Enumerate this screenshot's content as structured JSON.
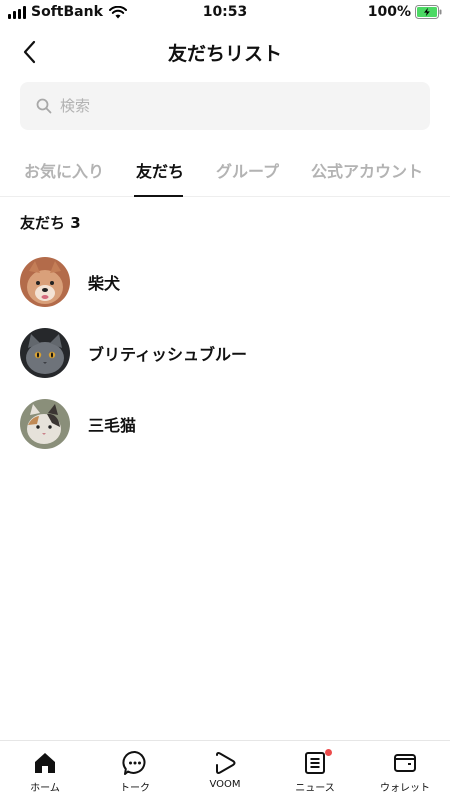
{
  "status_bar": {
    "carrier": "SoftBank",
    "time": "10:53",
    "battery": "100%"
  },
  "header": {
    "title": "友だちリスト"
  },
  "search": {
    "placeholder": "検索"
  },
  "tabs": [
    {
      "label": "お気に入り",
      "active": false
    },
    {
      "label": "友だち",
      "active": true
    },
    {
      "label": "グループ",
      "active": false
    },
    {
      "label": "公式アカウント",
      "active": false
    }
  ],
  "section": {
    "title": "友だち 3"
  },
  "friends": [
    {
      "name": "柴犬",
      "avatar": "shiba-dog-photo"
    },
    {
      "name": "ブリティッシュブルー",
      "avatar": "british-blue-cat-photo"
    },
    {
      "name": "三毛猫",
      "avatar": "calico-cat-photo"
    }
  ],
  "bottom_nav": [
    {
      "label": "ホーム",
      "icon": "home-icon",
      "active": true
    },
    {
      "label": "トーク",
      "icon": "chat-icon",
      "active": false
    },
    {
      "label": "VOOM",
      "icon": "voom-icon",
      "active": false
    },
    {
      "label": "ニュース",
      "icon": "news-icon",
      "active": false,
      "badge": true
    },
    {
      "label": "ウォレット",
      "icon": "wallet-icon",
      "active": false
    }
  ],
  "colors": {
    "active_text": "#111111",
    "inactive_tab": "#b3b3b3",
    "search_bg": "#f4f4f4",
    "badge": "#ec4b4b",
    "battery": "#4cd964"
  }
}
